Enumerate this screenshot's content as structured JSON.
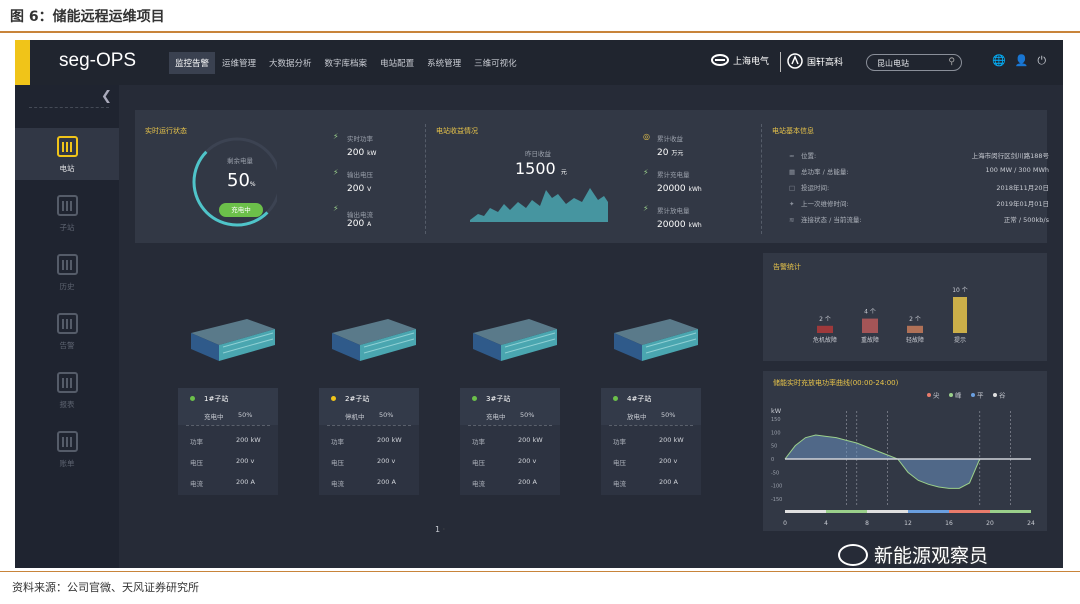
{
  "figure": {
    "title": "图 6：储能远程运维项目",
    "source": "资料来源：公司官微、天风证券研究所",
    "watermark": "新能源观察员"
  },
  "app": {
    "logo": "seg-OPS",
    "accent": "#f0c419"
  },
  "nav": [
    "监控告警",
    "运维管理",
    "大数据分析",
    "数字库档案",
    "电站配置",
    "系统管理",
    "三维可视化"
  ],
  "brands": {
    "brand1": "上海电气",
    "brand2": "国轩高科"
  },
  "search": {
    "value": "昆山电站"
  },
  "sidebar": {
    "items": [
      {
        "label": "电站"
      },
      {
        "label": "子站"
      },
      {
        "label": "历史"
      },
      {
        "label": "告警"
      },
      {
        "label": "报表"
      },
      {
        "label": "账单"
      }
    ]
  },
  "realtime": {
    "title": "实时运行状态",
    "soc_label": "剩余电量",
    "soc_value": "50",
    "soc_unit": "%",
    "soc_fraction": 0.5,
    "charge_badge": "充电中",
    "power_label": "实时功率",
    "power_value": "200",
    "power_unit": "kW",
    "voltage_label": "输出电压",
    "voltage_value": "200",
    "voltage_unit": "V",
    "current_label": "输出电流",
    "current_value": "200",
    "current_unit": "A"
  },
  "revenue": {
    "title": "电站收益情况",
    "yesterday_label": "昨日收益",
    "yesterday_value": "1500",
    "yesterday_unit": "元",
    "total_label": "累计收益",
    "total_value": "20",
    "total_unit": "万元",
    "charge_label": "累计充电量",
    "charge_value": "20000",
    "charge_unit": "kWh",
    "discharge_label": "累计放电量",
    "discharge_value": "20000",
    "discharge_unit": "kWh"
  },
  "station_info": {
    "title": "电站基本信息",
    "rows": [
      {
        "label": "位置:",
        "value": "上海市闵行区剑川路188号"
      },
      {
        "label": "总功率 / 总能量:",
        "value": "100 MW / 300 MWh"
      },
      {
        "label": "投运时间:",
        "value": "2018年11月20日"
      },
      {
        "label": "上一次维修时间:",
        "value": "2019年01月01日"
      },
      {
        "label": "连接状态 / 当前流量:",
        "value": "正常 / 500kb/s"
      }
    ]
  },
  "substations": [
    {
      "name": "1#子站",
      "status": "充电中",
      "pct": "50%",
      "dot": "#6cc04a",
      "power_label": "功率",
      "power": "200 kW",
      "voltage_label": "电压",
      "voltage": "200 v",
      "current_label": "电流",
      "current": "200 A"
    },
    {
      "name": "2#子站",
      "status": "停机中",
      "pct": "50%",
      "dot": "#f0c419",
      "power_label": "功率",
      "power": "200 kW",
      "voltage_label": "电压",
      "voltage": "200 v",
      "current_label": "电流",
      "current": "200 A"
    },
    {
      "name": "3#子站",
      "status": "充电中",
      "pct": "50%",
      "dot": "#6cc04a",
      "power_label": "功率",
      "power": "200 kW",
      "voltage_label": "电压",
      "voltage": "200 v",
      "current_label": "电流",
      "current": "200 A"
    },
    {
      "name": "4#子站",
      "status": "放电中",
      "pct": "50%",
      "dot": "#6cc04a",
      "power_label": "功率",
      "power": "200 kW",
      "voltage_label": "电压",
      "voltage": "200 v",
      "current_label": "电流",
      "current": "200 A"
    }
  ],
  "pager": {
    "current": "1"
  },
  "alarm_chart": {
    "title": "告警统计",
    "chart_data": {
      "type": "bar",
      "categories": [
        "危机故障",
        "重故障",
        "轻故障",
        "提示"
      ],
      "values": [
        2,
        4,
        2,
        10
      ],
      "value_labels": [
        "2 个",
        "4 个",
        "2 个",
        "10 个"
      ],
      "colors": [
        "#b23a3a",
        "#b85a5a",
        "#c77b5a",
        "#e8c44a"
      ]
    }
  },
  "power_chart": {
    "title": "储能实时充放电功率曲线(00:00-24:00)",
    "legend": [
      {
        "label": "尖",
        "color": "#e97b6b"
      },
      {
        "label": "峰",
        "color": "#9bd08b"
      },
      {
        "label": "平",
        "color": "#6a9fe0"
      },
      {
        "label": "谷",
        "color": "#e0e0e0"
      }
    ],
    "chart_data": {
      "type": "area",
      "ylabel": "kW",
      "xticks": [
        "0",
        "4",
        "8",
        "12",
        "16",
        "20",
        "24"
      ],
      "yticks": [
        "150",
        "100",
        "50",
        "0",
        "-50",
        "-100",
        "-150"
      ],
      "xlim": [
        0,
        24
      ],
      "ylim": [
        -150,
        150
      ],
      "x": [
        0,
        1,
        2,
        3,
        4,
        5,
        6,
        7,
        8,
        9,
        10,
        11,
        12,
        13,
        14,
        15,
        16,
        17,
        18,
        19,
        20,
        24
      ],
      "y": [
        0,
        50,
        80,
        90,
        85,
        80,
        70,
        60,
        45,
        30,
        15,
        0,
        -50,
        -80,
        -95,
        -105,
        -110,
        -110,
        -90,
        0,
        0,
        0
      ],
      "markers_x": [
        6,
        7,
        10,
        19,
        22
      ],
      "band_colors": [
        "#e0e0e0",
        "#9bd08b",
        "#e0e0e0",
        "#6a9fe0",
        "#e97b6b",
        "#9bd08b"
      ]
    }
  }
}
